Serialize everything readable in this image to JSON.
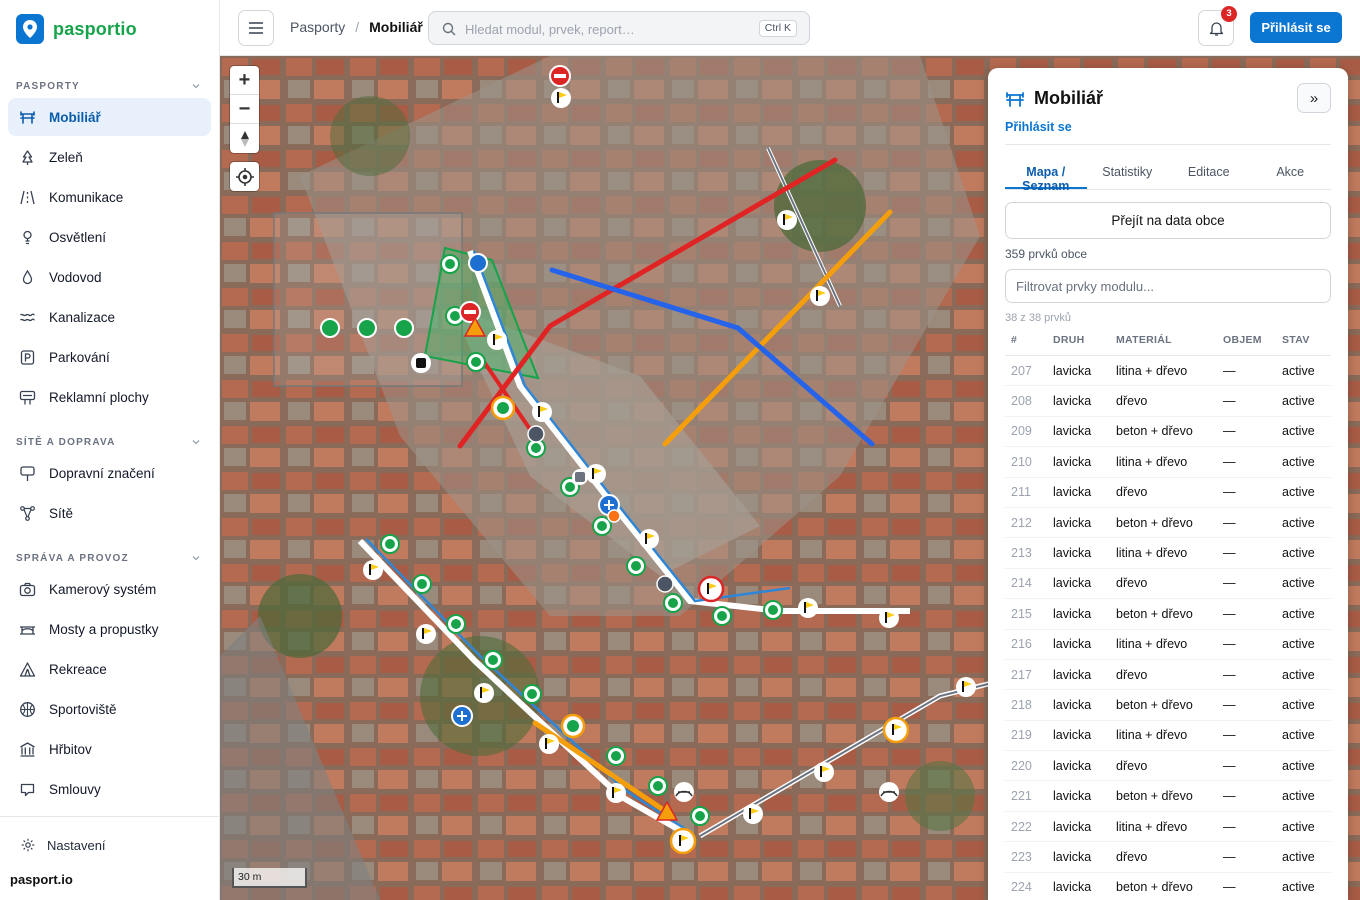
{
  "brand": {
    "name": "pasportio",
    "footer": "pasport.io"
  },
  "sidebar": {
    "sections": [
      {
        "title": "PASPORTY"
      },
      {
        "title": "SÍTĚ A DOPRAVA"
      },
      {
        "title": "SPRÁVA A PROVOZ"
      }
    ],
    "items": [
      {
        "label": "Mobiliář",
        "icon": "bench-icon"
      },
      {
        "label": "Zeleň",
        "icon": "tree-icon"
      },
      {
        "label": "Komunikace",
        "icon": "road-icon"
      },
      {
        "label": "Osvětlení",
        "icon": "lamp-icon"
      },
      {
        "label": "Vodovod",
        "icon": "droplet-icon"
      },
      {
        "label": "Kanalizace",
        "icon": "waves-icon"
      },
      {
        "label": "Parkování",
        "icon": "parking-icon"
      },
      {
        "label": "Reklamní plochy",
        "icon": "billboard-icon"
      },
      {
        "label": "Dopravní značení",
        "icon": "sign-icon"
      },
      {
        "label": "Sítě",
        "icon": "network-icon"
      },
      {
        "label": "Kamerový systém",
        "icon": "camera-icon"
      },
      {
        "label": "Mosty a propustky",
        "icon": "bridge-icon"
      },
      {
        "label": "Rekreace",
        "icon": "tent-icon"
      },
      {
        "label": "Sportoviště",
        "icon": "ball-icon"
      },
      {
        "label": "Hřbitov",
        "icon": "building-icon"
      },
      {
        "label": "Smlouvy",
        "icon": "document-icon"
      }
    ],
    "settings": "Nastavení"
  },
  "topbar": {
    "breadcrumb": [
      "Pasporty",
      "Mobiliář"
    ],
    "search_placeholder": "Hledat modul, prvek, report…",
    "search_shortcut": "Ctrl K",
    "notifications": "3",
    "login": "Přihlásit se"
  },
  "map": {
    "zoom_in": "+",
    "zoom_out": "−",
    "scale": "30 m"
  },
  "panel": {
    "title": "Mobiliář",
    "login_link": "Přihlásit se",
    "tabs": [
      "Mapa / Seznam",
      "Statistiky",
      "Editace",
      "Akce"
    ],
    "data_button": "Přejít na data obce",
    "total": "359 prvků obce",
    "filter_placeholder": "Filtrovat prvky modulu...",
    "shown": "38 z 38 prvků",
    "columns": [
      "#",
      "DRUH",
      "MATERIÁL",
      "OBJEM",
      "STAV"
    ],
    "rows": [
      [
        "207",
        "lavicka",
        "litina + dřevo",
        "—",
        "active"
      ],
      [
        "208",
        "lavicka",
        "dřevo",
        "—",
        "active"
      ],
      [
        "209",
        "lavicka",
        "beton + dřevo",
        "—",
        "active"
      ],
      [
        "210",
        "lavicka",
        "litina + dřevo",
        "—",
        "active"
      ],
      [
        "211",
        "lavicka",
        "dřevo",
        "—",
        "active"
      ],
      [
        "212",
        "lavicka",
        "beton + dřevo",
        "—",
        "active"
      ],
      [
        "213",
        "lavicka",
        "litina + dřevo",
        "—",
        "active"
      ],
      [
        "214",
        "lavicka",
        "dřevo",
        "—",
        "active"
      ],
      [
        "215",
        "lavicka",
        "beton + dřevo",
        "—",
        "active"
      ],
      [
        "216",
        "lavicka",
        "litina + dřevo",
        "—",
        "active"
      ],
      [
        "217",
        "lavicka",
        "dřevo",
        "—",
        "active"
      ],
      [
        "218",
        "lavicka",
        "beton + dřevo",
        "—",
        "active"
      ],
      [
        "219",
        "lavicka",
        "litina + dřevo",
        "—",
        "active"
      ],
      [
        "220",
        "lavicka",
        "dřevo",
        "—",
        "active"
      ],
      [
        "221",
        "lavicka",
        "beton + dřevo",
        "—",
        "active"
      ],
      [
        "222",
        "lavicka",
        "litina + dřevo",
        "—",
        "active"
      ],
      [
        "223",
        "lavicka",
        "dřevo",
        "—",
        "active"
      ],
      [
        "224",
        "lavicka",
        "beton + dřevo",
        "—",
        "active"
      ]
    ]
  },
  "colors": {
    "brand_green": "#16a34a",
    "primary_blue": "#0b76d1",
    "active_bg": "#e8f1fb",
    "line_red": "#e02424",
    "line_orange": "#f59e0b",
    "line_blue": "#2563eb",
    "badge_red": "#dc2626"
  }
}
